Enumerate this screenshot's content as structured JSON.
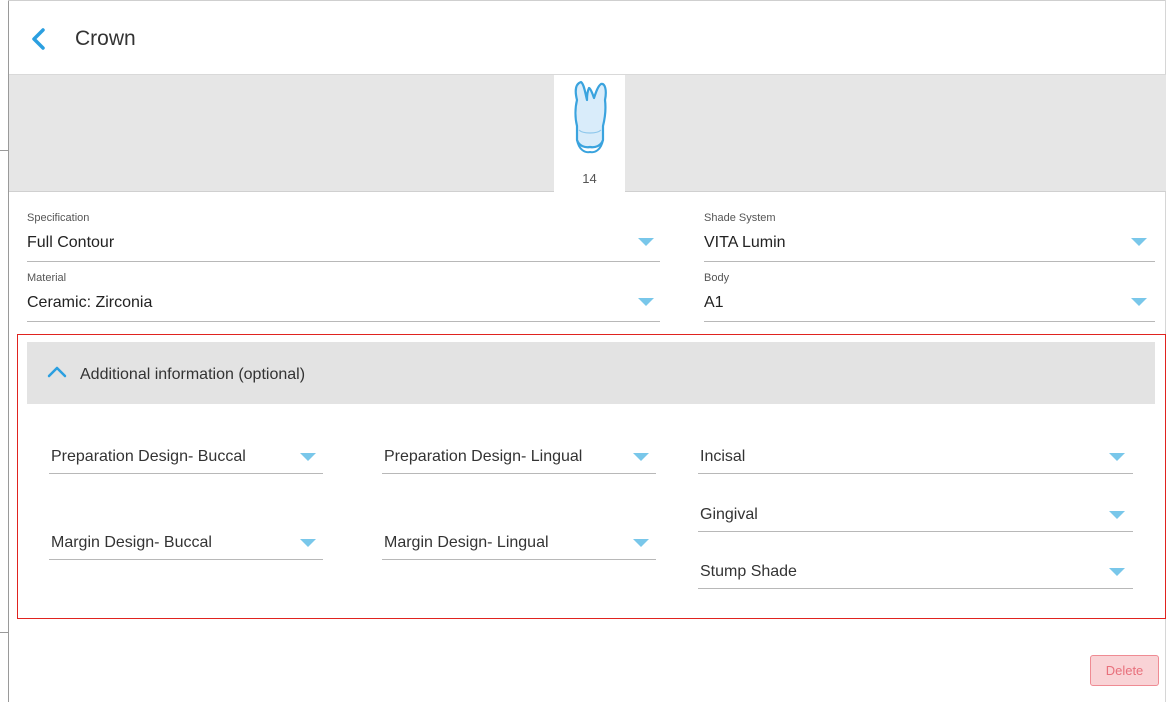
{
  "header": {
    "title": "Crown",
    "back_icon": "chevron-left-icon",
    "accent": "#2b9fe0"
  },
  "tooth": {
    "number": "14",
    "icon": "tooth-icon"
  },
  "fields": {
    "specification": {
      "label": "Specification",
      "value": "Full Contour"
    },
    "material": {
      "label": "Material",
      "value": "Ceramic: Zirconia"
    },
    "shade_system": {
      "label": "Shade System",
      "value": "VITA Lumin"
    },
    "body": {
      "label": "Body",
      "value": "A1"
    }
  },
  "additional": {
    "title": "Additional information (optional)",
    "expanded": true,
    "prep_buccal": "Preparation Design- Buccal",
    "prep_lingual": "Preparation Design- Lingual",
    "margin_buccal": "Margin Design- Buccal",
    "margin_lingual": "Margin Design- Lingual",
    "incisal": "Incisal",
    "gingival": "Gingival",
    "stump_shade": "Stump Shade"
  },
  "actions": {
    "delete_label": "Delete"
  },
  "colors": {
    "caret": "#79c7ea",
    "highlight_border": "#e0231f",
    "delete_bg": "#f9d3d6",
    "delete_text": "#e8707c"
  }
}
